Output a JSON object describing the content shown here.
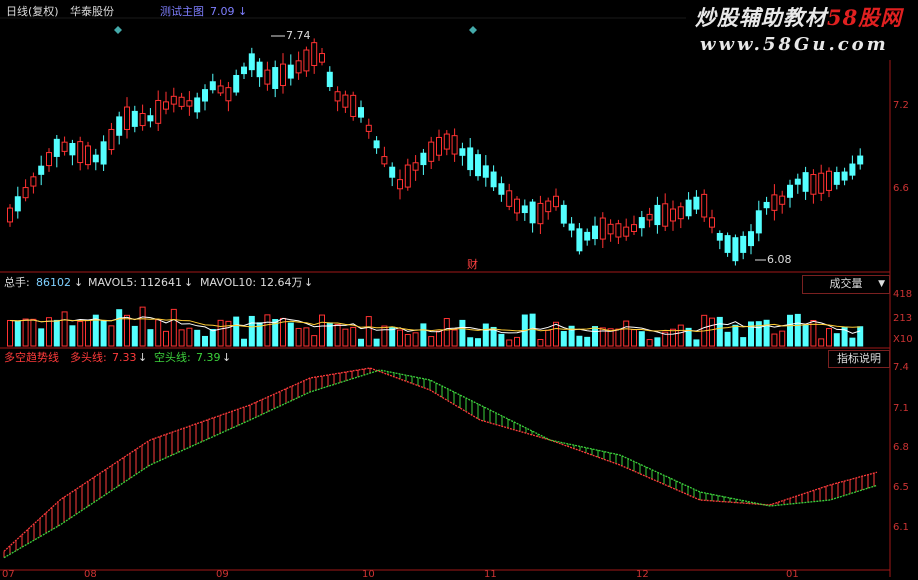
{
  "header": {
    "period_label": "日线(复权)",
    "stock_name": "华泰股份",
    "indicator_label": "测试主图",
    "indicator_value": "7.09",
    "down_arrow": "↓"
  },
  "watermark": {
    "line1_a": "炒股辅助教材",
    "line1_b": "58股网",
    "line2": "www.58Gu.com"
  },
  "price_panel": {
    "high_marker": "7.74",
    "low_marker": "6.08",
    "finance_marker": "财",
    "ticks": [
      "7.2",
      "6.6"
    ]
  },
  "volume_panel": {
    "total_label": "总手:",
    "total_value": "86102",
    "mavol5_label": "MAVOL5:",
    "mavol5_value": "112641",
    "mavol10_label": "MAVOL10:",
    "mavol10_value": "12.64万",
    "selector_label": "成交量",
    "ticks": [
      "418",
      "213",
      "X10"
    ]
  },
  "trend_panel": {
    "name": "多空趋势线",
    "long_label": "多头线:",
    "long_value": "7.33",
    "short_label": "空头线:",
    "short_value": "7.39",
    "help_button": "指标说明",
    "ticks": [
      "7.4",
      "7.1",
      "6.8",
      "6.5",
      "6.1"
    ]
  },
  "bottom_axis": {
    "labels": [
      "07",
      "08",
      "09",
      "10",
      "11",
      "12",
      "01"
    ]
  },
  "colors": {
    "up": "#ff3232",
    "down": "#54ffff",
    "long_line": "#ff3b3b",
    "short_line": "#3cd23c",
    "axis": "#a01818",
    "indicator_text": "#7f7fff"
  }
}
